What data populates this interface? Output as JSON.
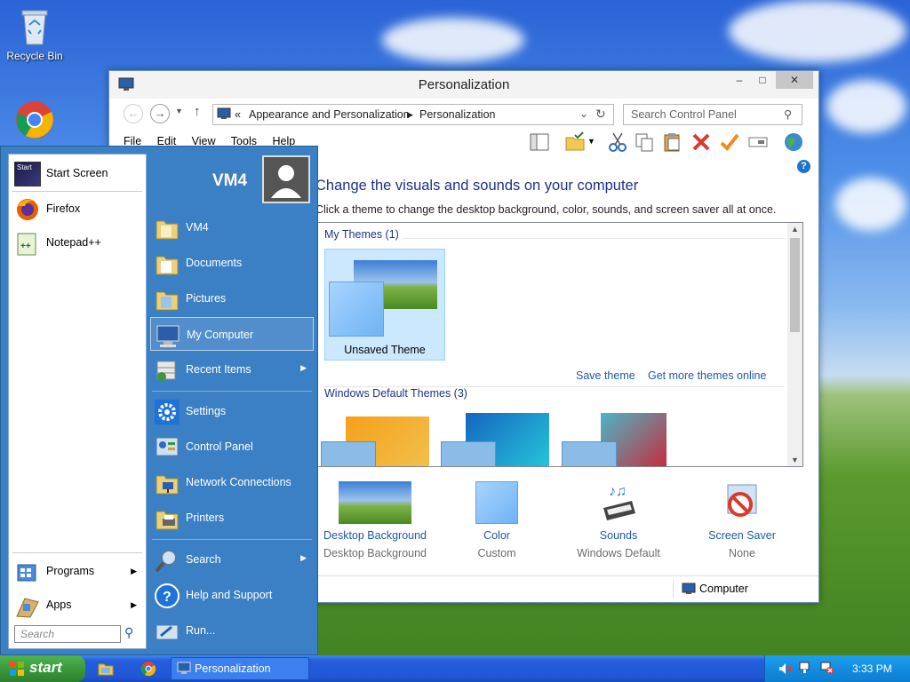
{
  "desktop": {
    "icons": [
      {
        "label": "Recycle Bin",
        "icon": "recycle-bin-icon"
      },
      {
        "label": "",
        "icon": "chrome-icon"
      }
    ]
  },
  "window": {
    "title": "Personalization",
    "controls": {
      "minimize": "–",
      "maximize": "□",
      "close": "✕"
    },
    "breadcrumb": {
      "prefix": "«",
      "parts": [
        "Appearance and Personalization",
        "Personalization"
      ]
    },
    "search": {
      "placeholder": "Search Control Panel"
    },
    "menu": [
      "File",
      "Edit",
      "View",
      "Tools",
      "Help"
    ],
    "heading": "Change the visuals and sounds on your computer",
    "subheading": "Click a theme to change the desktop background, color, sounds, and screen saver all at once.",
    "themes": {
      "my_group": "My Themes (1)",
      "selected_theme": "Unsaved Theme",
      "save_link": "Save theme",
      "online_link": "Get more themes online",
      "default_group": "Windows Default Themes (3)"
    },
    "bottom": [
      {
        "label": "Desktop Background",
        "sub": "Desktop Background"
      },
      {
        "label": "Color",
        "sub": "Custom"
      },
      {
        "label": "Sounds",
        "sub": "Windows Default"
      },
      {
        "label": "Screen Saver",
        "sub": "None"
      }
    ],
    "status": "Computer"
  },
  "startmenu": {
    "user": "VM4",
    "left_items": [
      {
        "label": "Start Screen",
        "icon": "start-screen-icon"
      },
      {
        "label": "Firefox",
        "icon": "firefox-icon"
      },
      {
        "label": "Notepad++",
        "icon": "notepad-plus-plus-icon"
      }
    ],
    "programs": "Programs",
    "apps": "Apps",
    "search_placeholder": "Search",
    "start_screen_badge": "Start",
    "right_items": [
      {
        "label": "VM4",
        "icon": "user-folder-icon"
      },
      {
        "label": "Documents",
        "icon": "documents-folder-icon"
      },
      {
        "label": "Pictures",
        "icon": "pictures-folder-icon"
      },
      {
        "label": "My Computer",
        "icon": "computer-icon"
      },
      {
        "label": "Recent Items",
        "icon": "recent-items-icon"
      },
      {
        "label": "Settings",
        "icon": "settings-gear-icon"
      },
      {
        "label": "Control Panel",
        "icon": "control-panel-icon"
      },
      {
        "label": "Network Connections",
        "icon": "network-connections-icon"
      },
      {
        "label": "Printers",
        "icon": "printers-icon"
      },
      {
        "label": "Search",
        "icon": "search-magnifier-icon"
      },
      {
        "label": "Help and Support",
        "icon": "help-icon"
      },
      {
        "label": "Run...",
        "icon": "run-icon"
      }
    ]
  },
  "taskbar": {
    "start_label": "start",
    "task": "Personalization",
    "clock": "3:33 PM"
  },
  "colors": {
    "start_menu_blue": "#3b7fc4",
    "link_blue": "#1e5aa8",
    "heading_blue": "#1e3287",
    "taskbar_blue": "#245edb",
    "start_green": "#3b9a3b"
  }
}
